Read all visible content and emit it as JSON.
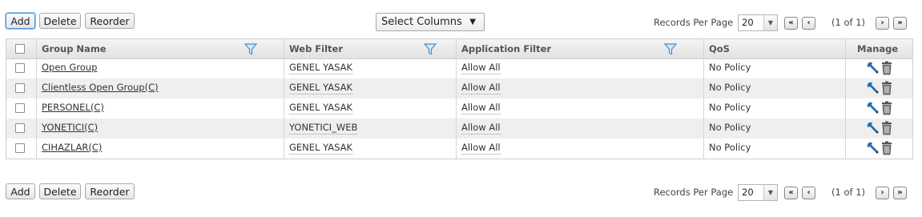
{
  "toolbar": {
    "add_label": "Add",
    "delete_label": "Delete",
    "reorder_label": "Reorder",
    "select_columns_label": "Select Columns",
    "select_columns_arrow": "▼"
  },
  "pagination": {
    "records_per_page_label": "Records Per Page",
    "records_per_page_value": "20",
    "first_label": "«",
    "prev_label": "‹",
    "next_label": "›",
    "last_label": "»",
    "page_info": "(1 of 1)"
  },
  "table": {
    "headers": {
      "group_name": "Group Name",
      "web_filter": "Web Filter",
      "application_filter": "Application Filter",
      "qos": "QoS",
      "manage": "Manage"
    },
    "rows": [
      {
        "group_name": "Open Group",
        "web_filter": "GENEL YASAK",
        "application_filter": "Allow All",
        "qos": "No Policy"
      },
      {
        "group_name": "Clientless Open Group(C)",
        "web_filter": "GENEL YASAK",
        "application_filter": "Allow All",
        "qos": "No Policy"
      },
      {
        "group_name": "PERSONEL(C)",
        "web_filter": "GENEL YASAK",
        "application_filter": "Allow All",
        "qos": "No Policy"
      },
      {
        "group_name": "YONETICI(C)",
        "web_filter": "YONETICI_WEB",
        "application_filter": "Allow All",
        "qos": "No Policy"
      },
      {
        "group_name": "CIHAZLAR(C)",
        "web_filter": "GENEL YASAK",
        "application_filter": "Allow All",
        "qos": "No Policy"
      }
    ]
  },
  "colors": {
    "header_text": "#555555",
    "row_alt": "#efefef",
    "filter_icon": "#4a8fcc",
    "focus_border": "#4a90d9"
  },
  "icons": [
    "filter-icon",
    "wrench-icon",
    "trash-icon",
    "first-page-icon",
    "prev-page-icon",
    "next-page-icon",
    "last-page-icon"
  ]
}
